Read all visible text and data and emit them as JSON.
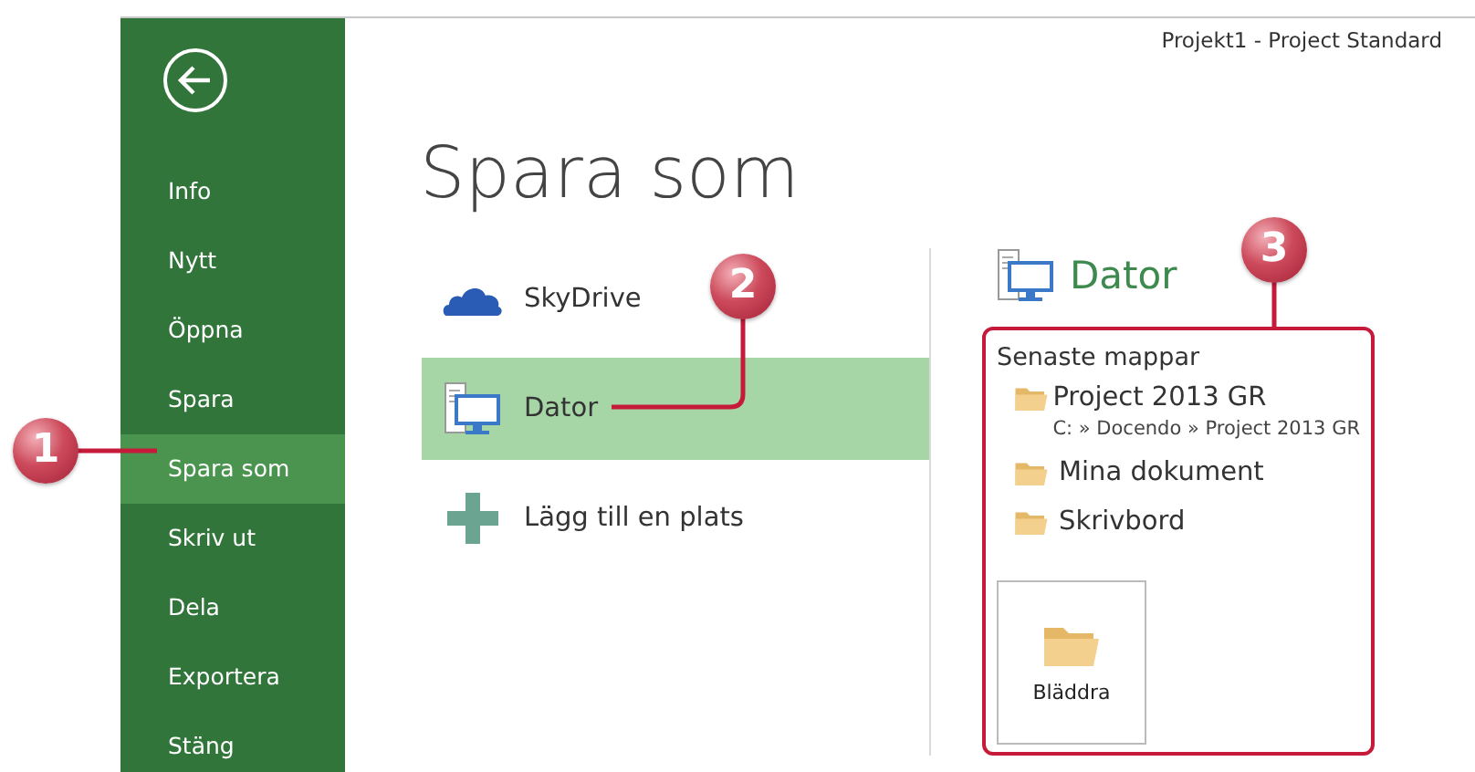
{
  "window": {
    "title": "Projekt1 - Project Standard"
  },
  "sidebar": {
    "items": [
      {
        "label": "Info",
        "selected": false
      },
      {
        "label": "Nytt",
        "selected": false
      },
      {
        "label": "Öppna",
        "selected": false
      },
      {
        "label": "Spara",
        "selected": false
      },
      {
        "label": "Spara som",
        "selected": true
      },
      {
        "label": "Skriv ut",
        "selected": false
      },
      {
        "label": "Dela",
        "selected": false
      },
      {
        "label": "Exportera",
        "selected": false
      },
      {
        "label": "Stäng",
        "selected": false
      }
    ]
  },
  "page_title": "Spara som",
  "places": [
    {
      "kind": "cloud",
      "label": "SkyDrive",
      "selected": false
    },
    {
      "kind": "computer",
      "label": "Dator",
      "selected": true
    },
    {
      "kind": "add",
      "label": "Lägg till en plats",
      "selected": false
    }
  ],
  "location": {
    "title": "Dator",
    "section": "Senaste mappar",
    "folders": [
      {
        "name": "Project 2013 GR",
        "path": "C: » Docendo » Project 2013 GR"
      },
      {
        "name": "Mina dokument"
      },
      {
        "name": "Skrivbord"
      }
    ],
    "browse": "Bläddra"
  },
  "callouts": [
    {
      "label": "1"
    },
    {
      "label": "2"
    },
    {
      "label": "3"
    }
  ]
}
